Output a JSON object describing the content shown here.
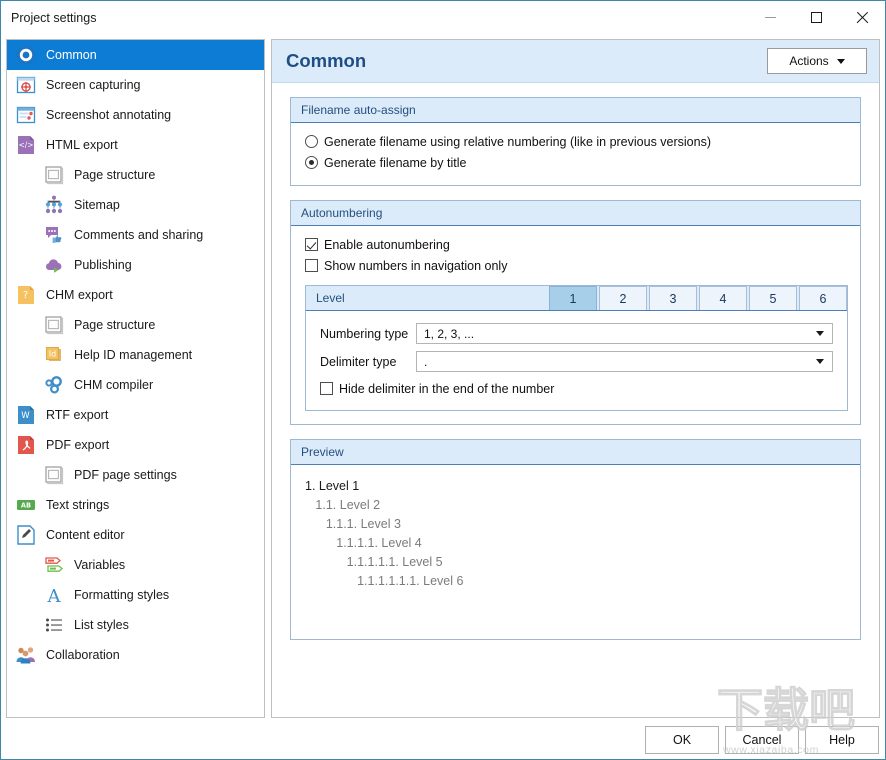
{
  "window": {
    "title": "Project settings",
    "minimize_label": "Minimize",
    "maximize_label": "Maximize",
    "close_label": "Close"
  },
  "sidebar": {
    "items": [
      {
        "label": "Common",
        "icon": "common-icon",
        "level": 0,
        "selected": true
      },
      {
        "label": "Screen capturing",
        "icon": "screen-capturing-icon",
        "level": 0,
        "selected": false
      },
      {
        "label": "Screenshot annotating",
        "icon": "screenshot-annotating-icon",
        "level": 0,
        "selected": false
      },
      {
        "label": "HTML export",
        "icon": "html-export-icon",
        "level": 0,
        "selected": false
      },
      {
        "label": "Page structure",
        "icon": "page-structure-icon",
        "level": 1,
        "selected": false
      },
      {
        "label": "Sitemap",
        "icon": "sitemap-icon",
        "level": 1,
        "selected": false
      },
      {
        "label": "Comments and sharing",
        "icon": "comments-sharing-icon",
        "level": 1,
        "selected": false
      },
      {
        "label": "Publishing",
        "icon": "publishing-icon",
        "level": 1,
        "selected": false
      },
      {
        "label": "CHM export",
        "icon": "chm-export-icon",
        "level": 0,
        "selected": false
      },
      {
        "label": "Page structure",
        "icon": "page-structure-icon",
        "level": 1,
        "selected": false
      },
      {
        "label": "Help ID management",
        "icon": "help-id-icon",
        "level": 1,
        "selected": false
      },
      {
        "label": "CHM compiler",
        "icon": "chm-compiler-icon",
        "level": 1,
        "selected": false
      },
      {
        "label": "RTF export",
        "icon": "rtf-export-icon",
        "level": 0,
        "selected": false
      },
      {
        "label": "PDF export",
        "icon": "pdf-export-icon",
        "level": 0,
        "selected": false
      },
      {
        "label": "PDF page settings",
        "icon": "pdf-page-settings-icon",
        "level": 1,
        "selected": false
      },
      {
        "label": "Text strings",
        "icon": "text-strings-icon",
        "level": 0,
        "selected": false
      },
      {
        "label": "Content editor",
        "icon": "content-editor-icon",
        "level": 0,
        "selected": false
      },
      {
        "label": "Variables",
        "icon": "variables-icon",
        "level": 1,
        "selected": false
      },
      {
        "label": "Formatting styles",
        "icon": "formatting-styles-icon",
        "level": 1,
        "selected": false
      },
      {
        "label": "List styles",
        "icon": "list-styles-icon",
        "level": 1,
        "selected": false
      },
      {
        "label": "Collaboration",
        "icon": "collaboration-icon",
        "level": 0,
        "selected": false
      }
    ]
  },
  "content": {
    "title": "Common",
    "actions_button": "Actions",
    "filename_group": {
      "header": "Filename auto-assign",
      "options": [
        {
          "label": "Generate filename using relative numbering (like in previous versions)",
          "checked": false
        },
        {
          "label": "Generate filename by title",
          "checked": true
        }
      ]
    },
    "autonumbering_group": {
      "header": "Autonumbering",
      "checkboxes": [
        {
          "label": "Enable autonumbering",
          "checked": true
        },
        {
          "label": "Show numbers in navigation only",
          "checked": false
        }
      ]
    },
    "level_group": {
      "header": "Level",
      "tabs": [
        "1",
        "2",
        "3",
        "4",
        "5",
        "6"
      ],
      "active_tab": "1",
      "numbering_type_label": "Numbering type",
      "numbering_type_value": "1, 2, 3, ...",
      "delimiter_type_label": "Delimiter type",
      "delimiter_type_value": ".",
      "hide_delimiter": {
        "label": "Hide delimiter in the end of the number",
        "checked": false
      }
    },
    "preview_group": {
      "header": "Preview",
      "lines": [
        "1. Level 1",
        "   1.1. Level 2",
        "      1.1.1. Level 3",
        "         1.1.1.1. Level 4",
        "            1.1.1.1.1. Level 5",
        "               1.1.1.1.1.1. Level 6"
      ]
    }
  },
  "footer": {
    "ok": "OK",
    "cancel": "Cancel",
    "help": "Help"
  },
  "watermark": {
    "cn": "下载吧",
    "url": "www.xiazaiba.com"
  },
  "colors": {
    "accent_selected": "#0c7cd5",
    "header_band": "#dcebf9",
    "title_text": "#1f4e86",
    "tab_active": "#a8cfea",
    "window_border": "#3f87a6"
  }
}
